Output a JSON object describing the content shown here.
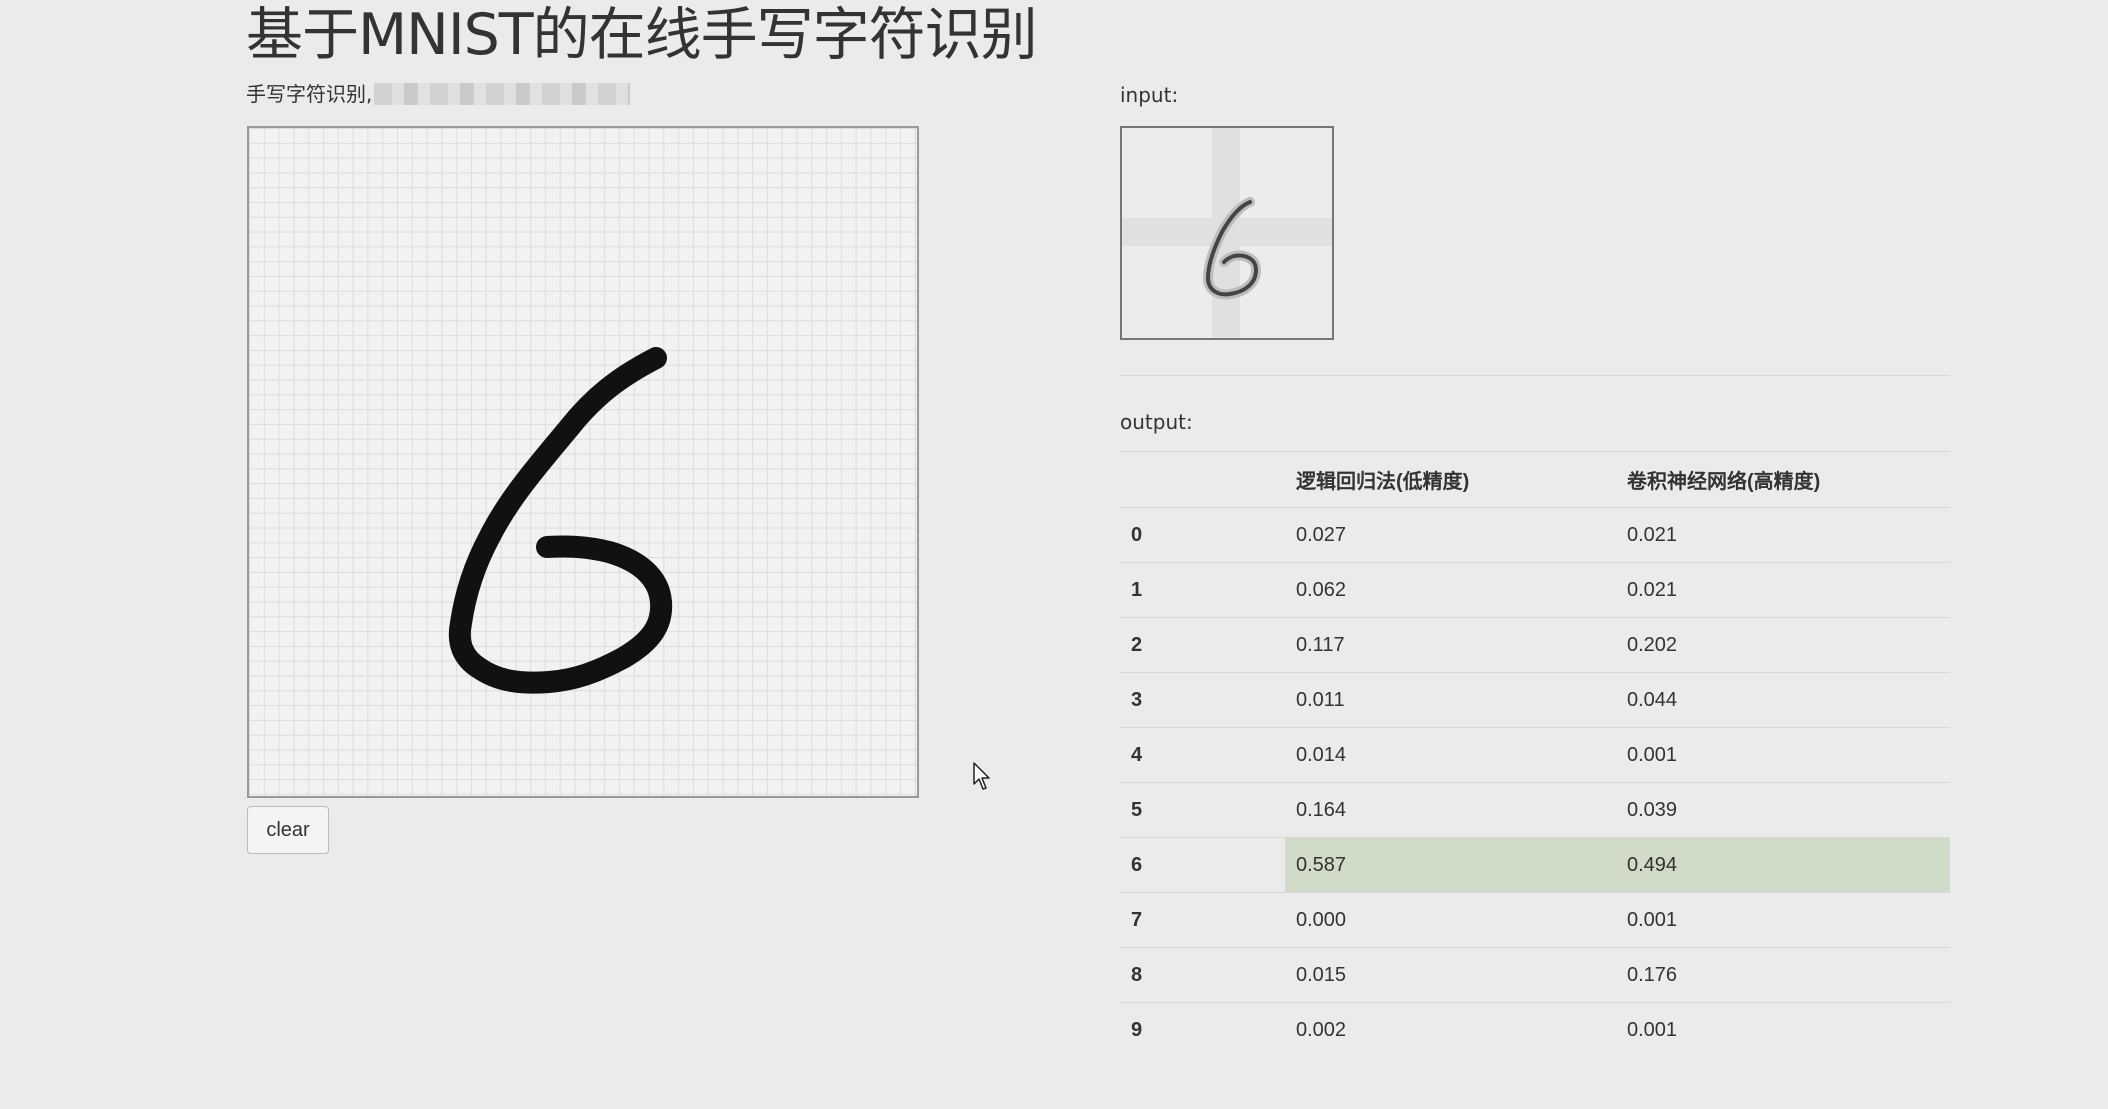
{
  "page": {
    "title": "基于MNIST的在线手写字符识别",
    "subtitle": "手写字符识别,"
  },
  "canvas": {
    "clear_label": "clear",
    "drawn_digit": "6"
  },
  "input": {
    "label": "input:",
    "preview_digit": "6"
  },
  "output": {
    "label": "output:",
    "columns": [
      "",
      "逻辑回归法(低精度)",
      "卷积神经网络(高精度)"
    ],
    "rows": [
      {
        "digit": "0",
        "lr": "0.027",
        "cnn": "0.021"
      },
      {
        "digit": "1",
        "lr": "0.062",
        "cnn": "0.021"
      },
      {
        "digit": "2",
        "lr": "0.117",
        "cnn": "0.202"
      },
      {
        "digit": "3",
        "lr": "0.011",
        "cnn": "0.044"
      },
      {
        "digit": "4",
        "lr": "0.014",
        "cnn": "0.001"
      },
      {
        "digit": "5",
        "lr": "0.164",
        "cnn": "0.039"
      },
      {
        "digit": "6",
        "lr": "0.587",
        "cnn": "0.494"
      },
      {
        "digit": "7",
        "lr": "0.000",
        "cnn": "0.001"
      },
      {
        "digit": "8",
        "lr": "0.015",
        "cnn": "0.176"
      },
      {
        "digit": "9",
        "lr": "0.002",
        "cnn": "0.001"
      }
    ],
    "highlight_row": 6,
    "highlight_color": "#d0dbc8"
  },
  "icons": {
    "cursor": "mouse-pointer-icon"
  }
}
